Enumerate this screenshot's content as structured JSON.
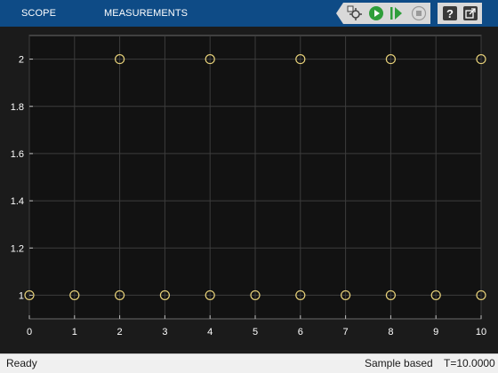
{
  "toolbar": {
    "tabs": [
      {
        "label": "SCOPE"
      },
      {
        "label": "MEASUREMENTS"
      }
    ],
    "buttons": [
      {
        "icon": "signal-select-icon"
      },
      {
        "icon": "run-icon"
      },
      {
        "icon": "step-forward-icon"
      },
      {
        "icon": "stop-icon"
      },
      {
        "icon": "help-icon"
      },
      {
        "icon": "undock-icon"
      }
    ],
    "colors": {
      "bar": "#0e4b86",
      "run": "#2e9e3a",
      "step": "#2e9e3a"
    }
  },
  "status": {
    "left": "Ready",
    "mode": "Sample based",
    "time": "T=10.0000"
  },
  "chart_data": {
    "type": "scatter",
    "title": "",
    "xlabel": "",
    "ylabel": "",
    "xlim": [
      0,
      10
    ],
    "ylim": [
      0.9,
      2.1
    ],
    "xticks": [
      0,
      1,
      2,
      3,
      4,
      5,
      6,
      7,
      8,
      9,
      10
    ],
    "yticks": [
      1,
      1.2,
      1.4,
      1.6,
      1.8,
      2
    ],
    "yticklabels": [
      "1",
      "1.2",
      "1.4",
      "1.6",
      "1.8",
      "2"
    ],
    "grid": true,
    "marker": "circle-open",
    "colors": {
      "marker": "#e8d27a",
      "axes_bg": "#121212",
      "grid": "#3c3c3c",
      "tick_text": "#ffffff"
    },
    "series": [
      {
        "x": [
          0,
          1,
          2,
          3,
          4,
          5,
          6,
          7,
          8,
          9,
          10
        ],
        "y": [
          1,
          1,
          1,
          1,
          1,
          1,
          1,
          1,
          1,
          1,
          1
        ]
      },
      {
        "x": [
          2,
          4,
          6,
          8,
          10
        ],
        "y": [
          2,
          2,
          2,
          2,
          2
        ]
      }
    ]
  }
}
